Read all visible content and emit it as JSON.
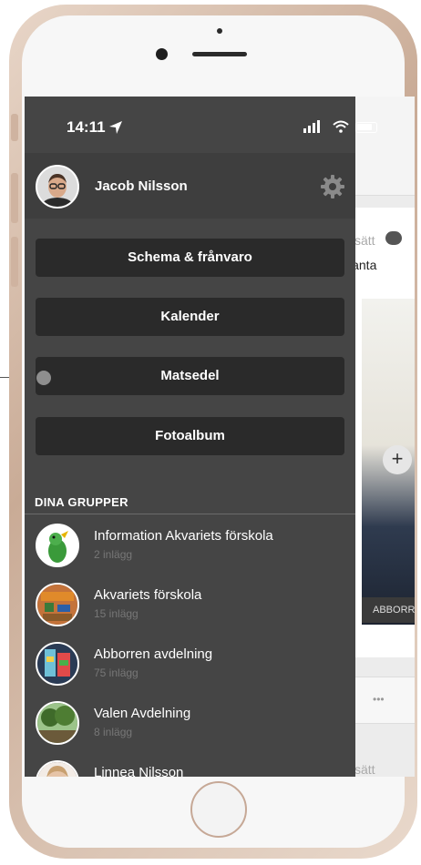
{
  "status_bar": {
    "time": "14:11"
  },
  "profile": {
    "name": "Jacob Nilsson"
  },
  "menu": [
    {
      "label": "Schema & frånvaro"
    },
    {
      "label": "Kalender"
    },
    {
      "label": "Matsedel"
    },
    {
      "label": "Fotoalbum"
    }
  ],
  "groups_header": "DINA GRUPPER",
  "groups": [
    {
      "name": "Information Akvariets förskola",
      "count": "2 inlägg"
    },
    {
      "name": "Akvariets förskola",
      "count": "15 inlägg"
    },
    {
      "name": "Abborren avdelning",
      "count": "75 inlägg"
    },
    {
      "name": "Valen Avdelning",
      "count": "8 inlägg"
    },
    {
      "name": "Linnea Nilsson",
      "count": ""
    }
  ],
  "background": {
    "text1": "sätt",
    "text2": "lanta",
    "photo_label": "ABBORR",
    "text3": "sätt"
  },
  "colors": {
    "drawer": "#454545",
    "button": "#2a2a2a"
  }
}
